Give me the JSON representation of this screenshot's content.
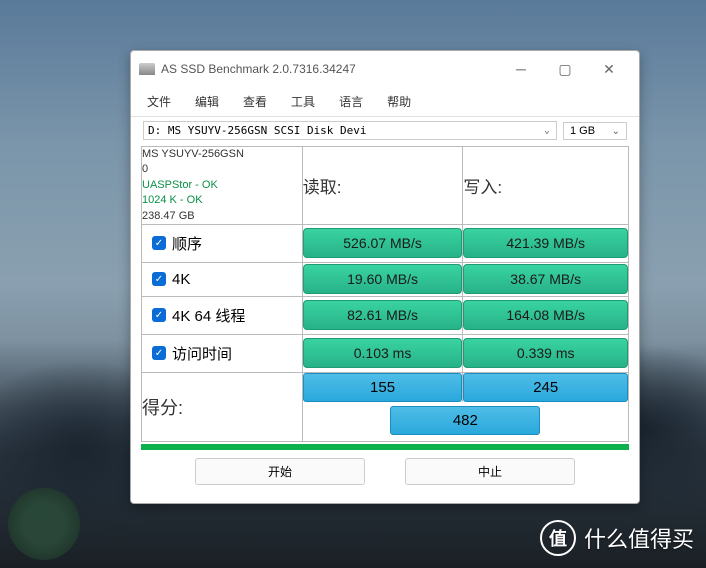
{
  "window": {
    "title": "AS SSD Benchmark 2.0.7316.34247"
  },
  "menu": {
    "file": "文件",
    "edit": "编辑",
    "view": "查看",
    "tools": "工具",
    "lang": "语言",
    "help": "帮助"
  },
  "toolbar": {
    "drive": "D: MS YSUYV-256GSN SCSI Disk Devi",
    "size": "1 GB"
  },
  "info": {
    "model_line1": "MS YSUYV-256GSN",
    "model_line2": "0",
    "driver": "UASPStor - OK",
    "align": "1024 K - OK",
    "capacity": "238.47 GB"
  },
  "headers": {
    "read": "读取:",
    "write": "写入:"
  },
  "rows": {
    "seq": {
      "label": "顺序",
      "read": "526.07 MB/s",
      "write": "421.39 MB/s"
    },
    "fk": {
      "label": "4K",
      "read": "19.60 MB/s",
      "write": "38.67 MB/s"
    },
    "fk64": {
      "label": "4K 64 线程",
      "read": "82.61 MB/s",
      "write": "164.08 MB/s"
    },
    "acc": {
      "label": "访问时间",
      "read": "0.103 ms",
      "write": "0.339 ms"
    }
  },
  "score": {
    "label": "得分:",
    "read": "155",
    "write": "245",
    "total": "482"
  },
  "buttons": {
    "start": "开始",
    "stop": "中止"
  },
  "watermark": {
    "char": "值",
    "text": "什么值得买"
  }
}
